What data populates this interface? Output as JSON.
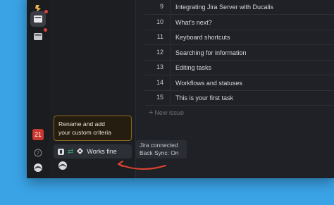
{
  "rail": {
    "notification_badge": "21"
  },
  "issues": [
    {
      "num": "9",
      "title": "Integrating Jira Server with Ducalis"
    },
    {
      "num": "10",
      "title": "What's next?"
    },
    {
      "num": "11",
      "title": "Keyboard shortcuts"
    },
    {
      "num": "12",
      "title": "Searching for information"
    },
    {
      "num": "13",
      "title": "Editing tasks"
    },
    {
      "num": "14",
      "title": "Workflows and statuses"
    },
    {
      "num": "15",
      "title": "This is your first task"
    }
  ],
  "new_issue_label": "New issue",
  "tooltip": {
    "line1": "Rename and add",
    "line2": "your custom criteria"
  },
  "integration": {
    "status_label": "Works fine"
  },
  "status_tip": {
    "line1": "Jira connected",
    "line2": "Back Sync: On"
  },
  "colors": {
    "background": "#3aa3e6",
    "window": "#1f2126",
    "badge": "#c9382f",
    "tooltip_border": "#8a6a1e",
    "arrow": "#e0452f",
    "sync_icon": "#3aa36a"
  }
}
